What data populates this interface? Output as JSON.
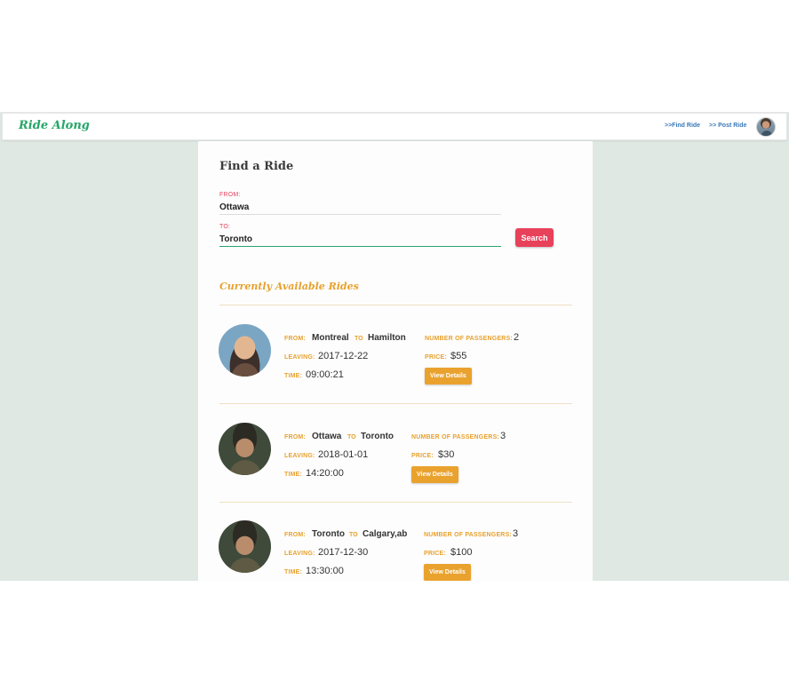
{
  "navbar": {
    "brand": "Ride Along",
    "links": [
      {
        "label": ">>Find Ride"
      },
      {
        "label": ">> Post Ride"
      }
    ]
  },
  "search": {
    "title": "Find a Ride",
    "from_label": "FROM:",
    "from_value": "Ottawa",
    "to_label": "TO:",
    "to_value": "Toronto",
    "button_label": "Search"
  },
  "rides_section": {
    "title": "Currently Available Rides"
  },
  "labels": {
    "from": "FROM:",
    "to": "TO",
    "leaving": "LEAVING:",
    "time": "TIME:",
    "passengers": "NUMBER OF PASSENGERS:",
    "price": "PRICE:",
    "details": "View Details"
  },
  "rides": [
    {
      "from": "Montreal",
      "to": "Hamilton",
      "leaving": "2017-12-22",
      "time": "09:00:21",
      "passengers": "2",
      "price": "$55"
    },
    {
      "from": "Ottawa",
      "to": "Toronto",
      "leaving": "2018-01-01",
      "time": "14:20:00",
      "passengers": "3",
      "price": "$30"
    },
    {
      "from": "Toronto",
      "to": "Calgary,ab",
      "leaving": "2017-12-30",
      "time": "13:30:00",
      "passengers": "3",
      "price": "$100"
    }
  ]
}
